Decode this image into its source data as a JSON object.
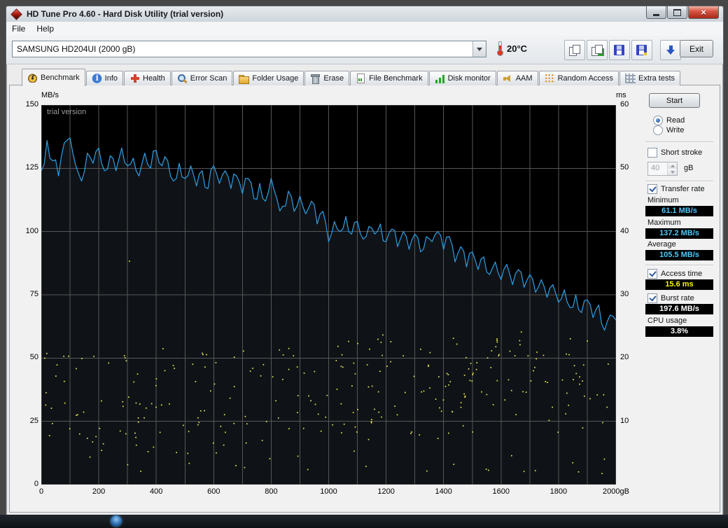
{
  "window": {
    "title": "HD Tune Pro 4.60 - Hard Disk Utility (trial version)"
  },
  "menu": {
    "items": [
      {
        "label": "File"
      },
      {
        "label": "Help"
      }
    ]
  },
  "toolbar": {
    "drive_combo": {
      "value": "SAMSUNG HD204UI (2000 gB)"
    },
    "temperature": "20°C",
    "buttons": [
      {
        "name": "copy-screenshot-button",
        "icon": "copy-icon"
      },
      {
        "name": "copy-results-button",
        "icon": "copy-add-icon"
      },
      {
        "name": "save-screenshot-button",
        "icon": "save-icon"
      },
      {
        "name": "save-results-button",
        "icon": "save-add-icon"
      },
      {
        "name": "export-button",
        "icon": "down-arrow-icon"
      }
    ],
    "exit_label": "Exit"
  },
  "tabs": [
    {
      "label": "Benchmark",
      "icon": "gauge-icon",
      "active": true
    },
    {
      "label": "Info",
      "icon": "info-icon",
      "active": false
    },
    {
      "label": "Health",
      "icon": "health-icon",
      "active": false
    },
    {
      "label": "Error Scan",
      "icon": "scan-icon",
      "active": false
    },
    {
      "label": "Folder Usage",
      "icon": "folder-icon",
      "active": false
    },
    {
      "label": "Erase",
      "icon": "erase-icon",
      "active": false
    },
    {
      "label": "File Benchmark",
      "icon": "file-benchmark-icon",
      "active": false
    },
    {
      "label": "Disk monitor",
      "icon": "disk-monitor-icon",
      "active": false
    },
    {
      "label": "AAM",
      "icon": "aam-icon",
      "active": false
    },
    {
      "label": "Random Access",
      "icon": "random-access-icon",
      "active": false
    },
    {
      "label": "Extra tests",
      "icon": "extra-tests-icon",
      "active": false
    }
  ],
  "panel": {
    "start_label": "Start",
    "read_label": "Read",
    "write_label": "Write",
    "read_selected": true,
    "write_selected": false,
    "short_stroke": {
      "label": "Short stroke",
      "checked": false,
      "value": "40",
      "unit": "gB"
    },
    "transfer_rate": {
      "label": "Transfer rate",
      "checked": true
    },
    "minimum": {
      "label": "Minimum",
      "value": "61.1 MB/s",
      "color": "#4fc8f8"
    },
    "maximum": {
      "label": "Maximum",
      "value": "137.2 MB/s",
      "color": "#4fc8f8"
    },
    "average": {
      "label": "Average",
      "value": "105.5 MB/s",
      "color": "#4fc8f8"
    },
    "access_time": {
      "label": "Access time",
      "checked": true,
      "value": "15.6 ms",
      "color": "#f5f500"
    },
    "burst_rate": {
      "label": "Burst rate",
      "checked": true,
      "value": "197.6 MB/s",
      "color": "#ffffff"
    },
    "cpu_usage": {
      "label": "CPU usage",
      "value": "3.8%",
      "color": "#ffffff"
    }
  },
  "chart_data": {
    "type": "line+scatter",
    "watermark": "trial version",
    "plot_bg": "#000000",
    "grid_color": "#565656",
    "x_max": 2000,
    "x_grid_step": 100,
    "x_unit": "gB",
    "x_ticks": [
      0,
      200,
      400,
      600,
      800,
      1000,
      1200,
      1400,
      1600,
      1800,
      2000
    ],
    "left_axis": {
      "label": "MB/s",
      "min": 0,
      "max": 150,
      "tick_step": 25
    },
    "right_axis": {
      "label": "ms",
      "min": 0,
      "max": 60,
      "tick_step": 10
    },
    "transfer_rate": {
      "name": "Read transfer rate (MB/s)",
      "color": "#2e9fe6",
      "fill": "rgba(96,120,144,0.16)",
      "x_step": 20,
      "values": [
        124,
        136,
        128,
        122,
        135,
        137,
        126,
        120,
        131,
        127,
        133,
        124,
        130,
        124,
        133,
        126,
        129,
        122,
        131,
        125,
        132,
        126,
        128,
        120,
        127,
        121,
        126,
        118,
        124,
        117,
        126,
        119,
        124,
        117,
        122,
        115,
        121,
        113,
        119,
        112,
        121,
        113,
        110,
        116,
        108,
        114,
        107,
        112,
        103,
        108,
        96,
        104,
        100,
        106,
        99,
        104,
        97,
        102,
        99,
        103,
        96,
        101,
        94,
        100,
        93,
        99,
        92,
        98,
        96,
        100,
        93,
        98,
        88,
        94,
        86,
        92,
        85,
        90,
        83,
        88,
        81,
        87,
        79,
        85,
        78,
        83,
        76,
        81,
        74,
        79,
        72,
        77,
        70,
        75,
        68,
        73,
        66,
        71,
        61,
        67,
        65
      ],
      "minimum": 61.1,
      "maximum": 137.2,
      "average": 105.5
    },
    "access_time": {
      "name": "Access time (ms)",
      "color": "#e6e655",
      "average_ms": 15.6,
      "count": 290,
      "ms_min": 1.5,
      "ms_max": 26.5,
      "seed": 7,
      "outliers": [
        [
          305,
          35.4
        ]
      ]
    }
  }
}
